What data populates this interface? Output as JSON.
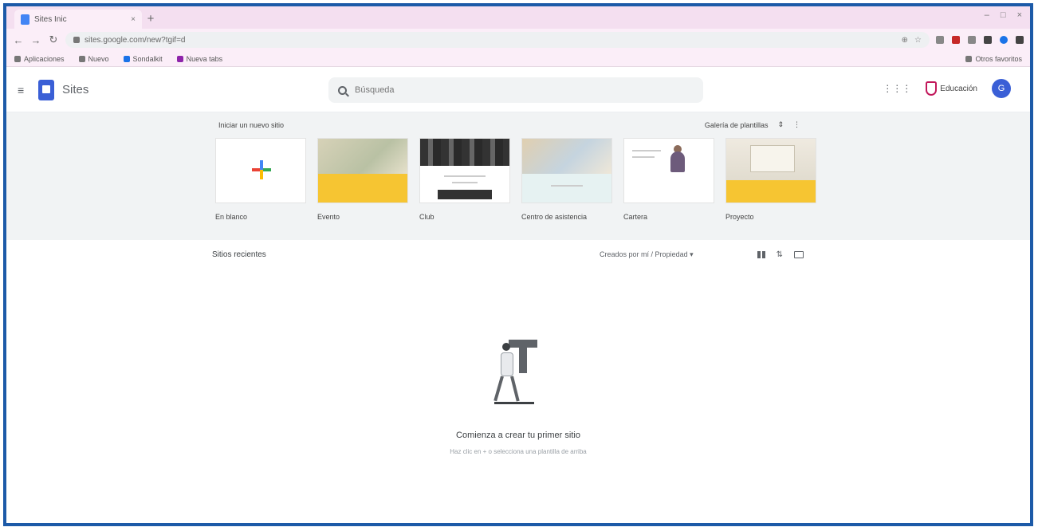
{
  "browser": {
    "tab_title": "Sites Inic",
    "tab_close": "×",
    "new_tab": "+",
    "window_controls": [
      "–",
      "□",
      "×"
    ],
    "url": "sites.google.com/new?tgif=d",
    "nav": {
      "back": "←",
      "forward": "→",
      "reload": "↻"
    },
    "omnibox_icons": [
      "⊕",
      "☆"
    ],
    "bookmarks": [
      {
        "label": "Aplicaciones",
        "icon": "apps-icon"
      },
      {
        "label": "Nuevo",
        "icon": "bookmark-icon"
      },
      {
        "label": "Sondalkit",
        "icon": "blue-bookmark-icon"
      },
      {
        "label": "Nueva tabs",
        "icon": "purple-bookmark-icon"
      }
    ],
    "reading_list": "Otros favoritos"
  },
  "app": {
    "menu_icon": "≡",
    "name": "Sites",
    "search_placeholder": "Búsqueda",
    "apps_icon": "⋮⋮⋮",
    "account_label": "Educación",
    "avatar_initial": "G"
  },
  "gallery": {
    "heading": "Iniciar un nuevo sitio",
    "gallery_link": "Galería de plantillas",
    "expand_icon": "⇕",
    "more_icon": "⋮",
    "templates": [
      {
        "label": "En blanco",
        "kind": "blank"
      },
      {
        "label": "Evento",
        "kind": "yellow"
      },
      {
        "label": "Club",
        "kind": "dark"
      },
      {
        "label": "Centro de asistencia",
        "kind": "mint"
      },
      {
        "label": "Cartera",
        "kind": "portfolio"
      },
      {
        "label": "Proyecto",
        "kind": "board"
      }
    ]
  },
  "recent": {
    "title": "Sitios recientes",
    "owner_filter": "Creados por mí / Propiedad ▾",
    "sort_icon": "⇅"
  },
  "empty_state": {
    "title": "Comienza a crear tu primer sitio",
    "subtitle": "Haz clic en + o selecciona una plantilla de arriba"
  }
}
